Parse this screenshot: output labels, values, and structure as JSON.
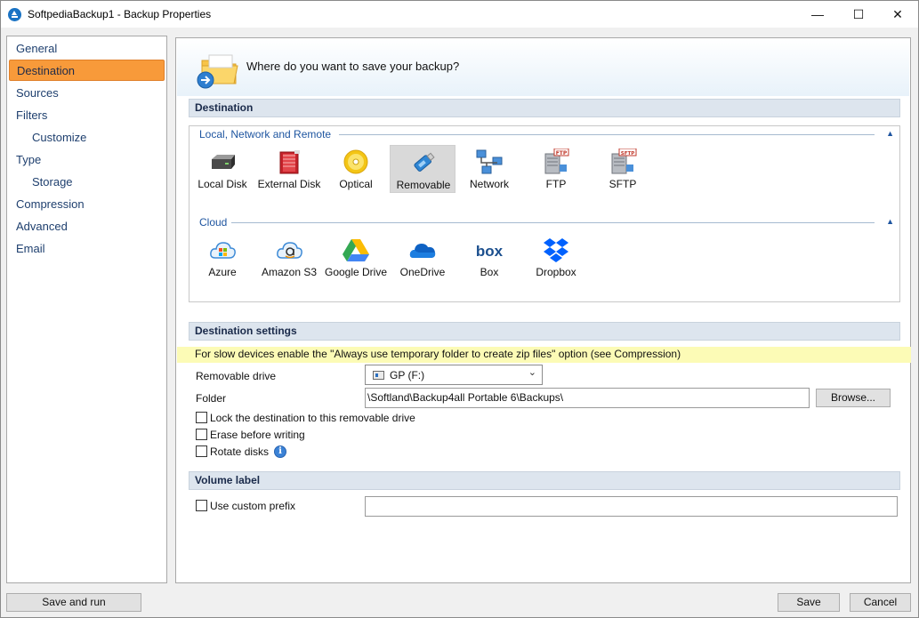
{
  "window": {
    "title": "SoftpediaBackup1 - Backup Properties",
    "controls": {
      "minimize": "—",
      "maximize": "☐",
      "close": "✕"
    }
  },
  "sidebar": {
    "items": [
      {
        "label": "General",
        "indent": false,
        "active": false
      },
      {
        "label": "Destination",
        "indent": false,
        "active": true
      },
      {
        "label": "Sources",
        "indent": false,
        "active": false
      },
      {
        "label": "Filters",
        "indent": false,
        "active": false
      },
      {
        "label": "Customize",
        "indent": true,
        "active": false
      },
      {
        "label": "Type",
        "indent": false,
        "active": false
      },
      {
        "label": "Storage",
        "indent": true,
        "active": false
      },
      {
        "label": "Compression",
        "indent": false,
        "active": false
      },
      {
        "label": "Advanced",
        "indent": false,
        "active": false
      },
      {
        "label": "Email",
        "indent": false,
        "active": false
      }
    ]
  },
  "banner": {
    "question": "Where do you want to save your backup?"
  },
  "destination": {
    "header": "Destination",
    "local_group": {
      "label": "Local, Network and Remote",
      "collapse": "▲",
      "tiles": [
        {
          "label": "Local Disk",
          "icon": "local-disk-icon"
        },
        {
          "label": "External Disk",
          "icon": "external-disk-icon"
        },
        {
          "label": "Optical",
          "icon": "optical-disc-icon"
        },
        {
          "label": "Removable",
          "icon": "usb-drive-icon",
          "selected": true
        },
        {
          "label": "Network",
          "icon": "network-icon"
        },
        {
          "label": "FTP",
          "icon": "ftp-server-icon",
          "badge": "FTP"
        },
        {
          "label": "SFTP",
          "icon": "sftp-server-icon",
          "badge": "SFTP"
        }
      ]
    },
    "cloud_group": {
      "label": "Cloud",
      "collapse": "▲",
      "tiles": [
        {
          "label": "Azure",
          "icon": "azure-cloud-icon"
        },
        {
          "label": "Amazon S3",
          "icon": "amazon-s3-icon"
        },
        {
          "label": "Google Drive",
          "icon": "google-drive-icon"
        },
        {
          "label": "OneDrive",
          "icon": "onedrive-icon"
        },
        {
          "label": "Box",
          "icon": "box-icon",
          "logo_text": "box"
        },
        {
          "label": "Dropbox",
          "icon": "dropbox-icon"
        }
      ]
    }
  },
  "settings": {
    "header": "Destination settings",
    "warning": "For slow devices enable the \"Always use temporary folder to create zip files\" option (see Compression)",
    "removable_drive_label": "Removable drive",
    "removable_drive_value": "GP (F:)",
    "folder_label": "Folder",
    "folder_value": "\\Softland\\Backup4all Portable 6\\Backups\\",
    "browse_label": "Browse...",
    "checkboxes": {
      "lock": {
        "label": "Lock the destination to this removable drive",
        "checked": false
      },
      "erase": {
        "label": "Erase before writing",
        "checked": false
      },
      "rotate": {
        "label": "Rotate disks",
        "checked": false
      }
    },
    "info_glyph": "i"
  },
  "volume": {
    "header": "Volume label",
    "prefix_label": "Use custom prefix",
    "prefix_checked": false,
    "prefix_value": ""
  },
  "footer": {
    "save_and_run": "Save and run",
    "save": "Save",
    "cancel": "Cancel"
  },
  "colors": {
    "active_nav": "#f89a3a",
    "section_header": "#dde5ee",
    "warning_bg": "#fcfbb6",
    "group_label": "#1e55a0"
  }
}
